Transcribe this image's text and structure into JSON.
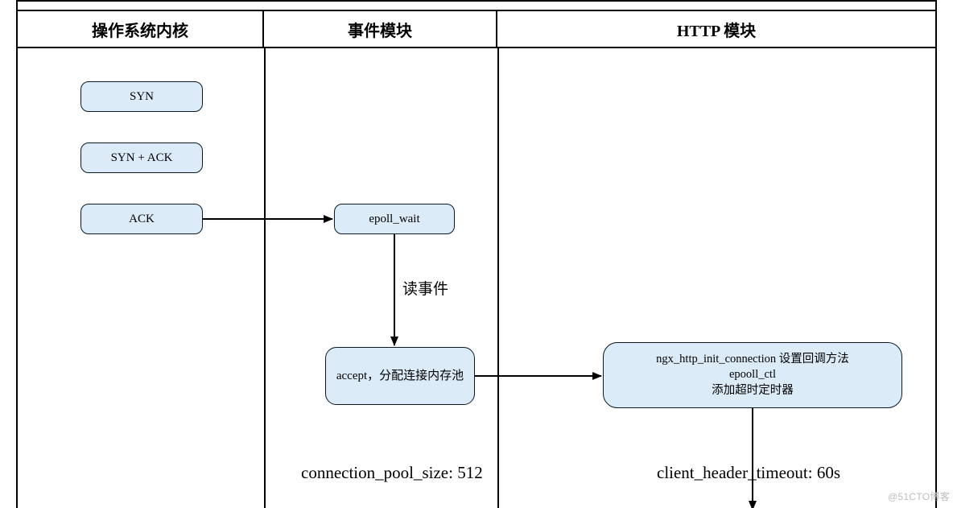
{
  "headers": {
    "col1": "操作系统内核",
    "col2": "事件模块",
    "col3": "HTTP 模块"
  },
  "nodes": {
    "syn": "SYN",
    "syn_ack": "SYN + ACK",
    "ack": "ACK",
    "epoll_wait": "epoll_wait",
    "accept": "accept，分配连接内存池",
    "http_init": "ngx_http_init_connection 设置回调方法\nepooll_ctl\n添加超时定时器"
  },
  "edges": {
    "read_event": "读事件"
  },
  "captions": {
    "conn_pool": "connection_pool_size: 512",
    "client_header": "client_header_timeout: 60s"
  },
  "watermark": "@51CTO博客"
}
